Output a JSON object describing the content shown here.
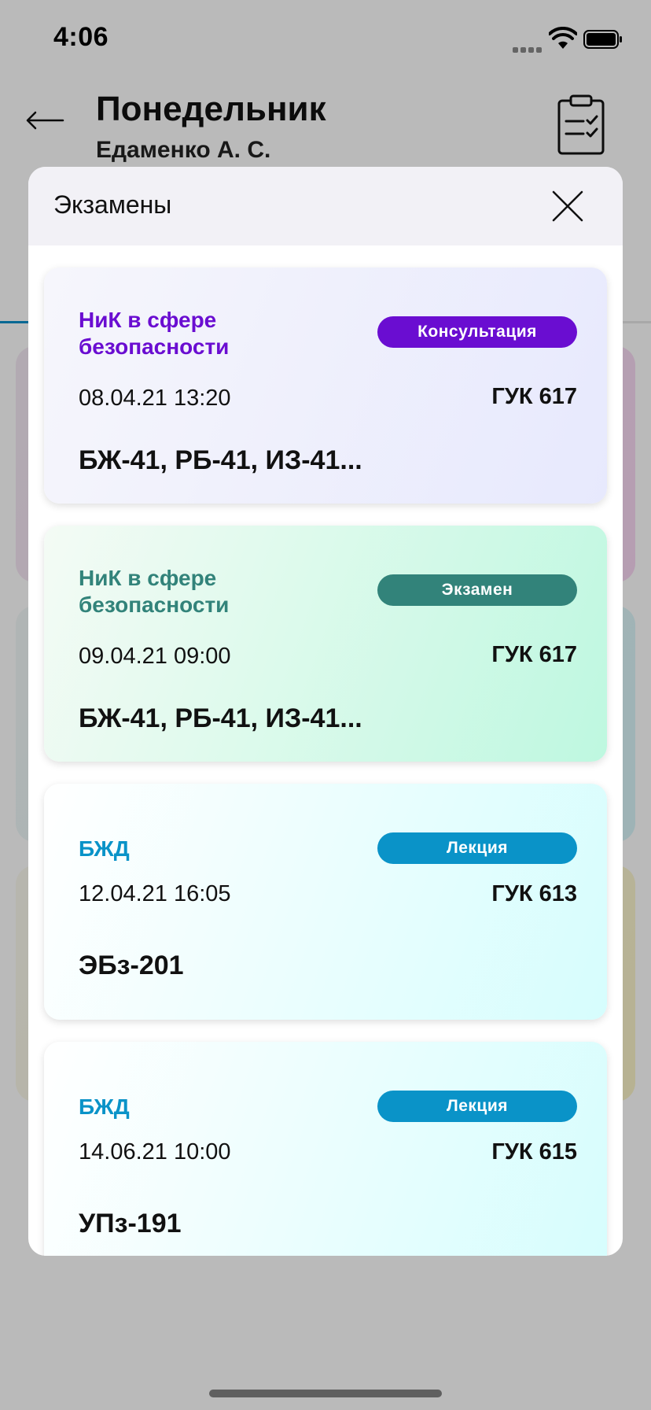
{
  "status_bar": {
    "time": "4:06"
  },
  "header": {
    "title": "Понедельник",
    "subtitle": "Едаменко А. С."
  },
  "sheet": {
    "title": "Экзамены",
    "cards": [
      {
        "subject": "НиК в сфере безопасности",
        "type": "Консультация",
        "datetime": "08.04.21 13:20",
        "room": "ГУК 617",
        "groups": "БЖ-41, РБ-41, ИЗ-41..."
      },
      {
        "subject": "НиК в сфере безопасности",
        "type": "Экзамен",
        "datetime": "09.04.21 09:00",
        "room": "ГУК 617",
        "groups": "БЖ-41, РБ-41, ИЗ-41..."
      },
      {
        "subject": "БЖД",
        "type": "Лекция",
        "datetime": "12.04.21 16:05",
        "room": "ГУК 613",
        "groups": "ЭБз-201"
      },
      {
        "subject": "БЖД",
        "type": "Лекция",
        "datetime": "14.06.21 10:00",
        "room": "ГУК 615",
        "groups": "УПз-191"
      }
    ]
  },
  "colors": {
    "consultation": "#6a0dd1",
    "exam": "#32837a",
    "lecture": "#0a93c8",
    "accent": "#0a8fca"
  }
}
